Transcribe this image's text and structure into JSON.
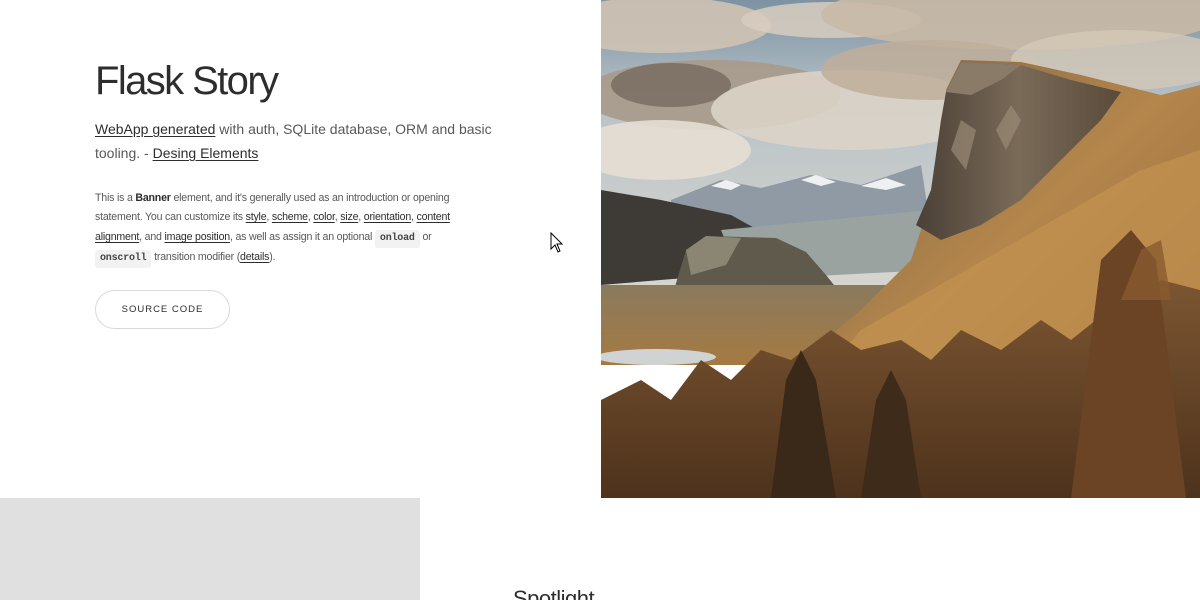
{
  "banner": {
    "title": "Flask Story",
    "lead": {
      "link1": "WebApp generated",
      "text1": " with auth, SQLite database, ORM and basic tooling. - ",
      "link2": "Desing Elements"
    },
    "desc": {
      "t1": "This is a ",
      "bold": "Banner",
      "t2": " element, and it's generally used as an introduction or opening statement. You can customize its ",
      "l_style": "style",
      "sep1": ", ",
      "l_scheme": "scheme",
      "sep2": ", ",
      "l_color": "color",
      "sep3": ", ",
      "l_size": "size",
      "sep4": ", ",
      "l_orientation": "orientation",
      "sep5": ", ",
      "l_content_alignment": "content alignment",
      "t3": ", and ",
      "l_image_position": "image position",
      "t4": ", as well as assign it an optional ",
      "code_onload": "onload",
      "t5": " or ",
      "code_onscroll": "onscroll",
      "t6": " transition modifier (",
      "l_details": "details",
      "t7": ")."
    },
    "button_label": "SOURCE CODE",
    "image_icon": "mountain-landscape-image"
  },
  "spotlight": {
    "title": "Spotlight"
  },
  "colors": {
    "heading": "#2d2d2d",
    "body_text": "#585858",
    "placeholder_gray": "#e0e0e0"
  }
}
